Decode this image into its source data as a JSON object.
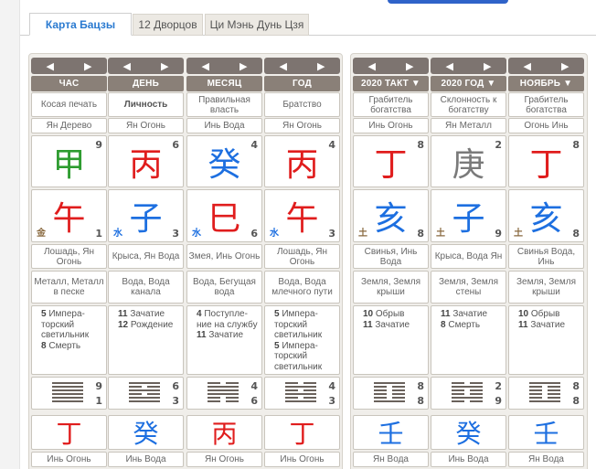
{
  "tabs": [
    "Карта Бацзы",
    "12 Дворцов",
    "Ци Мэнь Дунь Цзя"
  ],
  "nav": {
    "prev": "◀",
    "next": "▶"
  },
  "left_columns": [
    {
      "header": "ЧАС",
      "star": "Косая печать",
      "star_bold": false,
      "stem_element": "Ян Дерево",
      "stem": "甲",
      "stem_color": "#2e9c30",
      "stem_num": "9",
      "branch": "午",
      "branch_color": "#e01d1d",
      "branch_num": "1",
      "branch_elem": "金",
      "branch_elem_color": "#8a6a40",
      "animal": "Лошадь, Ян Огонь",
      "nayin": "Металл, Металл в песке",
      "stars": [
        {
          "n": "5",
          "t": "Импера-торский светильник"
        },
        {
          "n": "8",
          "t": "Смерть"
        }
      ],
      "hex_top": "9",
      "hex_bot": "1",
      "hex": [
        1,
        1,
        1,
        1,
        1,
        1
      ],
      "lower_stem": "丁",
      "lower_color": "#e01d1d",
      "lower_label": "Инь Огонь"
    },
    {
      "header": "ДЕНЬ",
      "star": "Личность",
      "star_bold": true,
      "stem_element": "Ян Огонь",
      "stem": "丙",
      "stem_color": "#e01d1d",
      "stem_num": "6",
      "branch": "子",
      "branch_color": "#1d6fe0",
      "branch_num": "3",
      "branch_elem": "水",
      "branch_elem_color": "#1d6fe0",
      "animal": "Крыса, Ян Вода",
      "nayin": "Вода, Вода канала",
      "stars": [
        {
          "n": "11",
          "t": "Зачатие"
        },
        {
          "n": "12",
          "t": "Рождение"
        }
      ],
      "hex_top": "6",
      "hex_bot": "3",
      "hex": [
        1,
        0,
        1,
        0,
        1,
        1
      ],
      "lower_stem": "癸",
      "lower_color": "#1d6fe0",
      "lower_label": "Инь Вода"
    },
    {
      "header": "МЕСЯЦ",
      "star": "Правильная власть",
      "star_bold": false,
      "stem_element": "Инь Вода",
      "stem": "癸",
      "stem_color": "#1d6fe0",
      "stem_num": "4",
      "branch": "巳",
      "branch_color": "#e01d1d",
      "branch_num": "6",
      "branch_elem": "水",
      "branch_elem_color": "#1d6fe0",
      "animal": "Змея, Инь Огонь",
      "nayin": "Вода, Бегущая вода",
      "stars": [
        {
          "n": "4",
          "t": "Поступле-ние на службу"
        },
        {
          "n": "11",
          "t": "Зачатие"
        }
      ],
      "hex_top": "4",
      "hex_bot": "6",
      "hex": [
        0,
        1,
        1,
        1,
        0,
        0
      ],
      "lower_stem": "丙",
      "lower_color": "#e01d1d",
      "lower_label": "Ян Огонь"
    },
    {
      "header": "ГОД",
      "star": "Братство",
      "star_bold": false,
      "stem_element": "Ян Огонь",
      "stem": "丙",
      "stem_color": "#e01d1d",
      "stem_num": "4",
      "branch": "午",
      "branch_color": "#e01d1d",
      "branch_num": "3",
      "branch_elem": "水",
      "branch_elem_color": "#1d6fe0",
      "animal": "Лошадь, Ян Огонь",
      "nayin": "Вода, Вода млечного пути",
      "stars": [
        {
          "n": "5",
          "t": "Импера-торский светильник"
        },
        {
          "n": "5",
          "t": "Импера-торский светильник"
        }
      ],
      "hex_top": "4",
      "hex_bot": "3",
      "hex": [
        0,
        1,
        0,
        1,
        0,
        1
      ],
      "lower_stem": "丁",
      "lower_color": "#e01d1d",
      "lower_label": "Инь Огонь"
    }
  ],
  "right_columns": [
    {
      "header": "2020 ТАКТ ▼",
      "star": "Грабитель богатства",
      "stem_element": "Инь Огонь",
      "stem": "丁",
      "stem_color": "#e01d1d",
      "stem_num": "8",
      "branch": "亥",
      "branch_color": "#1d6fe0",
      "branch_num": "8",
      "branch_elem": "土",
      "branch_elem_color": "#8a6a40",
      "animal": "Свинья, Инь Вода",
      "nayin": "Земля, Земля крыши",
      "stars": [
        {
          "n": "10",
          "t": "Обрыв"
        },
        {
          "n": "11",
          "t": "Зачатие"
        }
      ],
      "hex_top": "8",
      "hex_bot": "8",
      "hex": [
        1,
        0,
        0,
        0,
        0,
        1
      ],
      "lower_stem": "壬",
      "lower_color": "#1d6fe0",
      "lower_label": "Ян Вода"
    },
    {
      "header": "2020 ГОД ▼",
      "star": "Склонность к богатству",
      "stem_element": "Ян Металл",
      "stem": "庚",
      "stem_color": "#7a7a7a",
      "stem_num": "2",
      "branch": "子",
      "branch_color": "#1d6fe0",
      "branch_num": "9",
      "branch_elem": "土",
      "branch_elem_color": "#8a6a40",
      "animal": "Крыса, Вода Ян",
      "nayin": "Земля, Земля стены",
      "stars": [
        {
          "n": "11",
          "t": "Зачатие"
        },
        {
          "n": "8",
          "t": "Смерть"
        }
      ],
      "hex_top": "2",
      "hex_bot": "9",
      "hex": [
        0,
        1,
        0,
        0,
        1,
        0
      ],
      "lower_stem": "癸",
      "lower_color": "#1d6fe0",
      "lower_label": "Инь Вода"
    },
    {
      "header": "НОЯБРЬ ▼",
      "star": "Грабитель богатства",
      "stem_element": "Огонь Инь",
      "stem": "丁",
      "stem_color": "#e01d1d",
      "stem_num": "8",
      "branch": "亥",
      "branch_color": "#1d6fe0",
      "branch_num": "8",
      "branch_elem": "土",
      "branch_elem_color": "#8a6a40",
      "animal": "Свинья Вода, Инь",
      "nayin": "Земля, Земля крыши",
      "stars": [
        {
          "n": "10",
          "t": "Обрыв"
        },
        {
          "n": "11",
          "t": "Зачатие"
        }
      ],
      "hex_top": "8",
      "hex_bot": "8",
      "hex": [
        1,
        0,
        0,
        0,
        0,
        1
      ],
      "lower_stem": "壬",
      "lower_color": "#1d6fe0",
      "lower_label": "Ян Вода"
    }
  ]
}
